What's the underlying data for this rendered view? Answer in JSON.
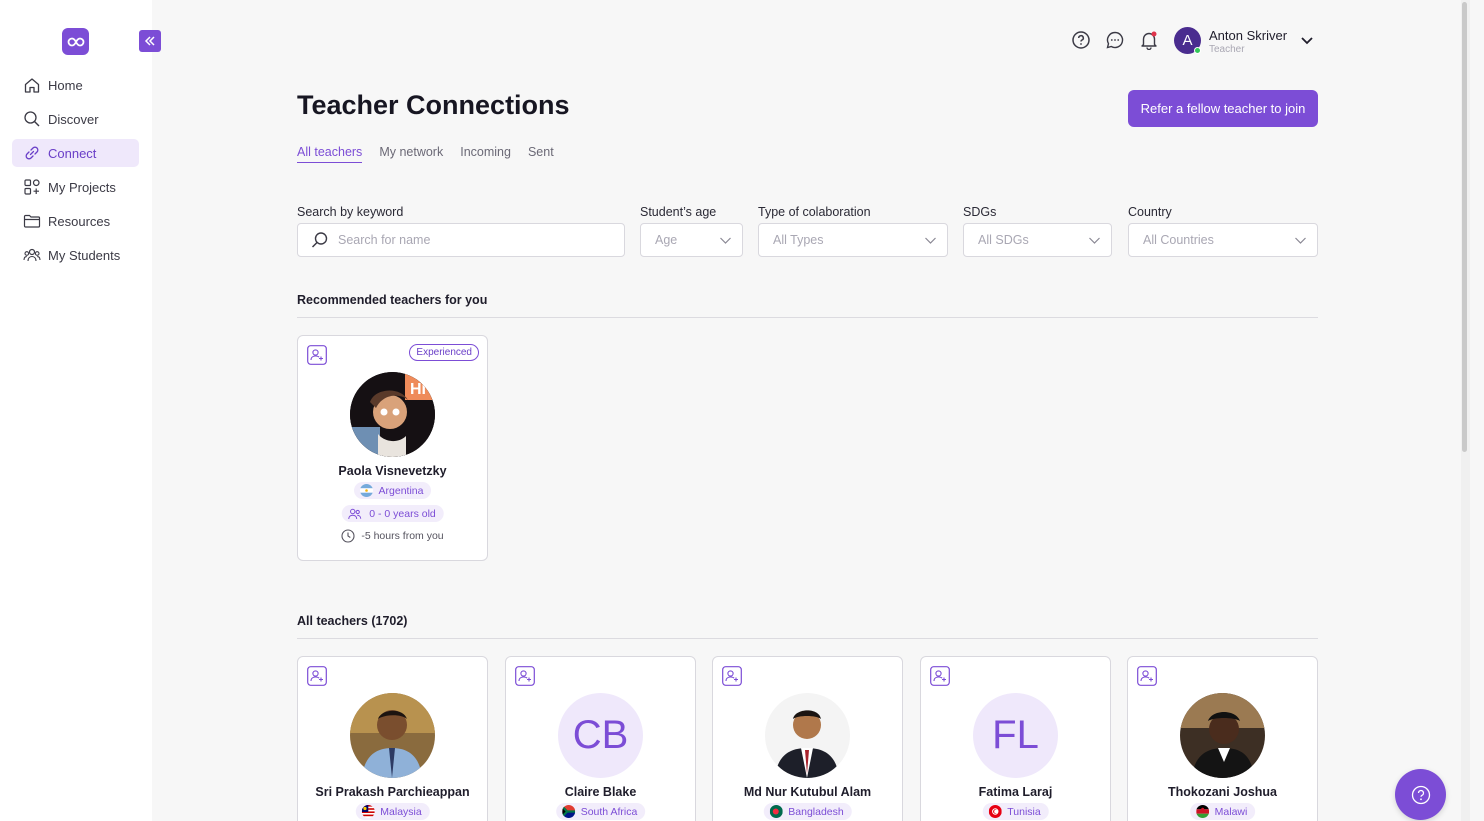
{
  "sidebar": {
    "items": [
      {
        "label": "Home",
        "icon": "home-icon"
      },
      {
        "label": "Discover",
        "icon": "search-icon"
      },
      {
        "label": "Connect",
        "icon": "link-icon",
        "active": true
      },
      {
        "label": "My Projects",
        "icon": "projects-icon"
      },
      {
        "label": "Resources",
        "icon": "folder-icon"
      },
      {
        "label": "My Students",
        "icon": "students-icon"
      }
    ]
  },
  "user": {
    "initial": "A",
    "name": "Anton Skriver",
    "role": "Teacher"
  },
  "header": {
    "title": "Teacher Connections",
    "refer_label": "Refer a fellow teacher to join",
    "tabs": [
      "All teachers",
      "My network",
      "Incoming",
      "Sent"
    ]
  },
  "filters": {
    "keyword": {
      "label": "Search by keyword",
      "placeholder": "Search for name"
    },
    "age": {
      "label": "Student’s age",
      "value": "Age"
    },
    "collab": {
      "label": "Type of colaboration",
      "value": "All Types"
    },
    "sdgs": {
      "label": "SDGs",
      "value": "All SDGs"
    },
    "country": {
      "label": "Country",
      "value": "All Countries"
    }
  },
  "recommended": {
    "title": "Recommended teachers for you",
    "cards": [
      {
        "name": "Paola Visnevetzky",
        "badge": "Experienced",
        "country": "Argentina",
        "age": "0 - 0 years old",
        "tz": "-5 hours from you"
      }
    ]
  },
  "all_teachers": {
    "title": "All teachers (1702)",
    "cards": [
      {
        "name": "Sri Prakash Parchieappan",
        "country": "Malaysia",
        "initials": ""
      },
      {
        "name": "Claire Blake",
        "country": "South Africa",
        "initials": "CB"
      },
      {
        "name": "Md Nur Kutubul Alam",
        "country": "Bangladesh",
        "initials": ""
      },
      {
        "name": "Fatima Laraj",
        "country": "Tunisia",
        "initials": "FL"
      },
      {
        "name": "Thokozani Joshua",
        "country": "Malawi",
        "initials": ""
      }
    ]
  },
  "colors": {
    "accent": "#7c4dd6",
    "accent_light": "#efe8fb",
    "text": "#1f1d2b"
  }
}
